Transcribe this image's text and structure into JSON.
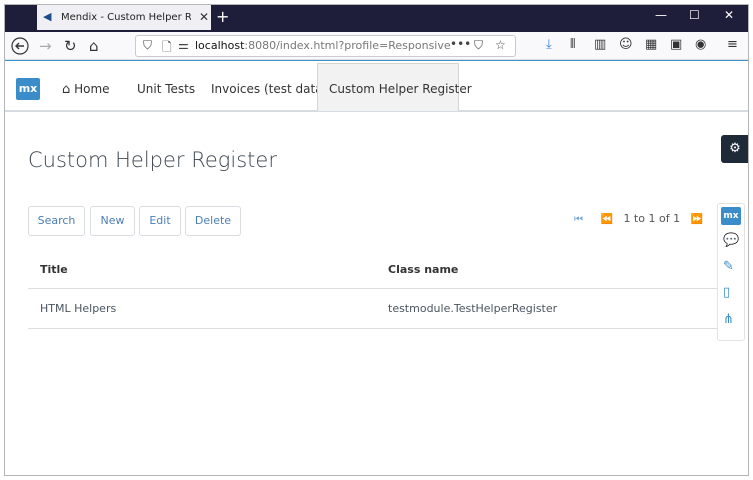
{
  "browser": {
    "tab_title": "Mendix - Custom Helper Regist",
    "tab_close": "✕",
    "new_tab": "+",
    "window_controls": [
      "—",
      "☐",
      "✕"
    ],
    "url_host": "localhost",
    "url_rest": ":8080/index.html?profile=Responsive",
    "more_actions": "•••",
    "menu": "≡"
  },
  "app": {
    "logo_text": "mx",
    "nav": {
      "home": "Home",
      "unit_tests": "Unit Tests",
      "invoices": "Invoices (test data)",
      "custom_helper": "Custom Helper Register"
    },
    "page_title": "Custom Helper Register",
    "toolbar": {
      "search": "Search",
      "new": "New",
      "edit": "Edit",
      "delete": "Delete"
    },
    "pager": {
      "text": "1 to 1 of 1"
    },
    "table": {
      "columns": [
        "Title",
        "Class name"
      ],
      "rows": [
        [
          "HTML Helpers",
          "testmodule.TestHelperRegister"
        ]
      ]
    },
    "dock": {
      "logo_text": "mx"
    }
  },
  "colors": {
    "accent": "#3a8dc9",
    "titlebar": "#1e1e3a",
    "header_stripe": "#3993d3",
    "button_text": "#4a7fb5"
  }
}
